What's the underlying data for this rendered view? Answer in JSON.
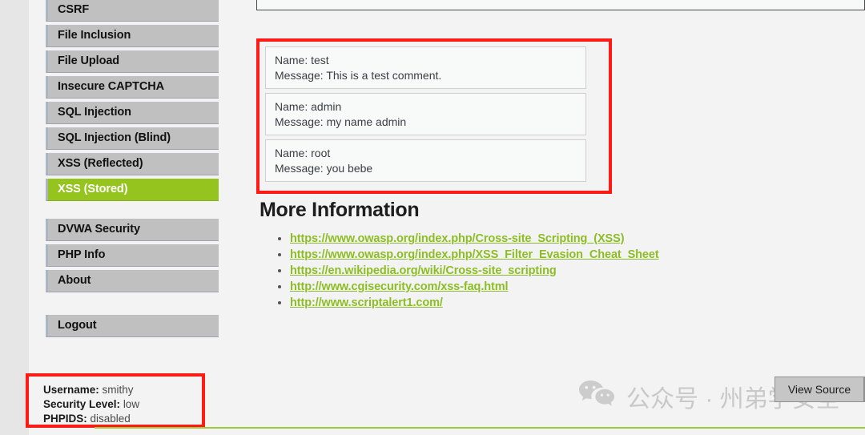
{
  "sidebar": {
    "items": [
      {
        "label": "CSRF",
        "active": false
      },
      {
        "label": "File Inclusion",
        "active": false
      },
      {
        "label": "File Upload",
        "active": false
      },
      {
        "label": "Insecure CAPTCHA",
        "active": false
      },
      {
        "label": "SQL Injection",
        "active": false
      },
      {
        "label": "SQL Injection (Blind)",
        "active": false
      },
      {
        "label": "XSS (Reflected)",
        "active": false
      },
      {
        "label": "XSS (Stored)",
        "active": true
      }
    ],
    "secondary_items": [
      {
        "label": "DVWA Security"
      },
      {
        "label": "PHP Info"
      },
      {
        "label": "About"
      }
    ],
    "logout_label": "Logout",
    "active_color": "#95c41f"
  },
  "status_box": {
    "username_label": "Username:",
    "username_value": "smithy",
    "security_level_label": "Security Level:",
    "security_level_value": "low",
    "phpids_label": "PHPIDS:",
    "phpids_value": "disabled",
    "highlight_color": "#ff1a15"
  },
  "guestbook": {
    "highlight_color": "#ff1a15",
    "comments": [
      {
        "name_line": "Name: test",
        "message_line": "Message: This is a test comment."
      },
      {
        "name_line": "Name: admin",
        "message_line": "Message: my name admin"
      },
      {
        "name_line": "Name: root",
        "message_line": "Message: you bebe"
      }
    ]
  },
  "more_information": {
    "heading": "More Information",
    "links": [
      "https://www.owasp.org/index.php/Cross-site_Scripting_(XSS)",
      "https://www.owasp.org/index.php/XSS_Filter_Evasion_Cheat_Sheet",
      "https://en.wikipedia.org/wiki/Cross-site_scripting",
      "http://www.cgisecurity.com/xss-faq.html",
      "http://www.scriptalert1.com/"
    ],
    "link_color": "#8dbd26"
  },
  "watermark": {
    "text": "公众号 · 州弟学安全",
    "icon": "wechat-icon",
    "color": "#c9c9c9"
  },
  "view_source": {
    "label": "View Source"
  },
  "footer": {
    "rule_color": "#9dc93b"
  }
}
